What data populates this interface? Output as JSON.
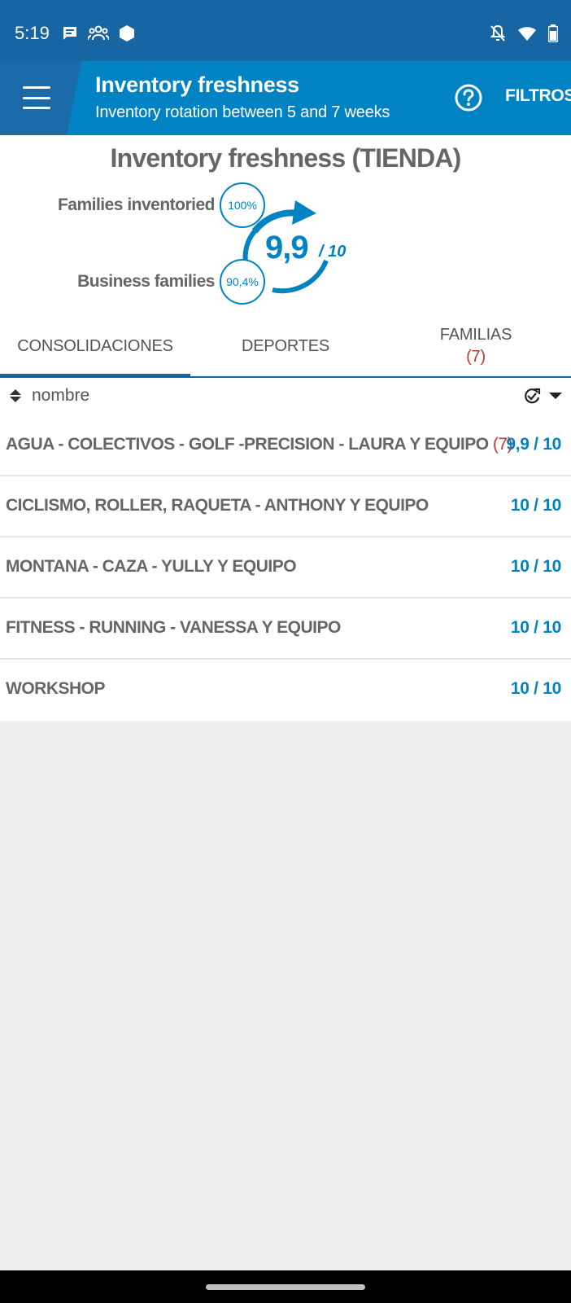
{
  "status_bar": {
    "time": "5:19",
    "left_icons": [
      "chat-icon",
      "people-icon",
      "hexagon-icon"
    ],
    "right_icons": [
      "notifications-off-icon",
      "wifi-icon",
      "battery-icon"
    ]
  },
  "app_bar": {
    "title": "Inventory freshness",
    "subtitle": "Inventory rotation between 5 and 7 weeks",
    "filters_label": "FILTROS",
    "colors": {
      "primary": "#0082c3",
      "dark": "#1865a3"
    }
  },
  "summary": {
    "title": "Inventory freshness (TIENDA)",
    "families_inventoried_label": "Families inventoried",
    "families_inventoried_value": "100%",
    "business_families_label": "Business families",
    "business_families_value": "90,4%",
    "score": "9,9",
    "score_max": "/ 10"
  },
  "tabs": [
    {
      "label": "CONSOLIDACIONES",
      "selected": true,
      "count": ""
    },
    {
      "label": "DEPORTES",
      "selected": false,
      "count": ""
    },
    {
      "label": "FAMILIAS",
      "selected": false,
      "count": "(7)"
    }
  ],
  "sort": {
    "label": "nombre"
  },
  "items": [
    {
      "name": "AGUA - COLECTIVOS - GOLF -PRECISION - LAURA Y EQUIPO",
      "count": "(7)",
      "score": "9,9 / 10"
    },
    {
      "name": "CICLISMO, ROLLER, RAQUETA - ANTHONY Y EQUIPO",
      "count": "",
      "score": "10 / 10"
    },
    {
      "name": "MONTANA - CAZA - YULLY Y EQUIPO",
      "count": "",
      "score": "10 / 10"
    },
    {
      "name": "FITNESS - RUNNING - VANESSA Y EQUIPO",
      "count": "",
      "score": "10 / 10"
    },
    {
      "name": "WORKSHOP",
      "count": "",
      "score": "10 / 10"
    }
  ]
}
